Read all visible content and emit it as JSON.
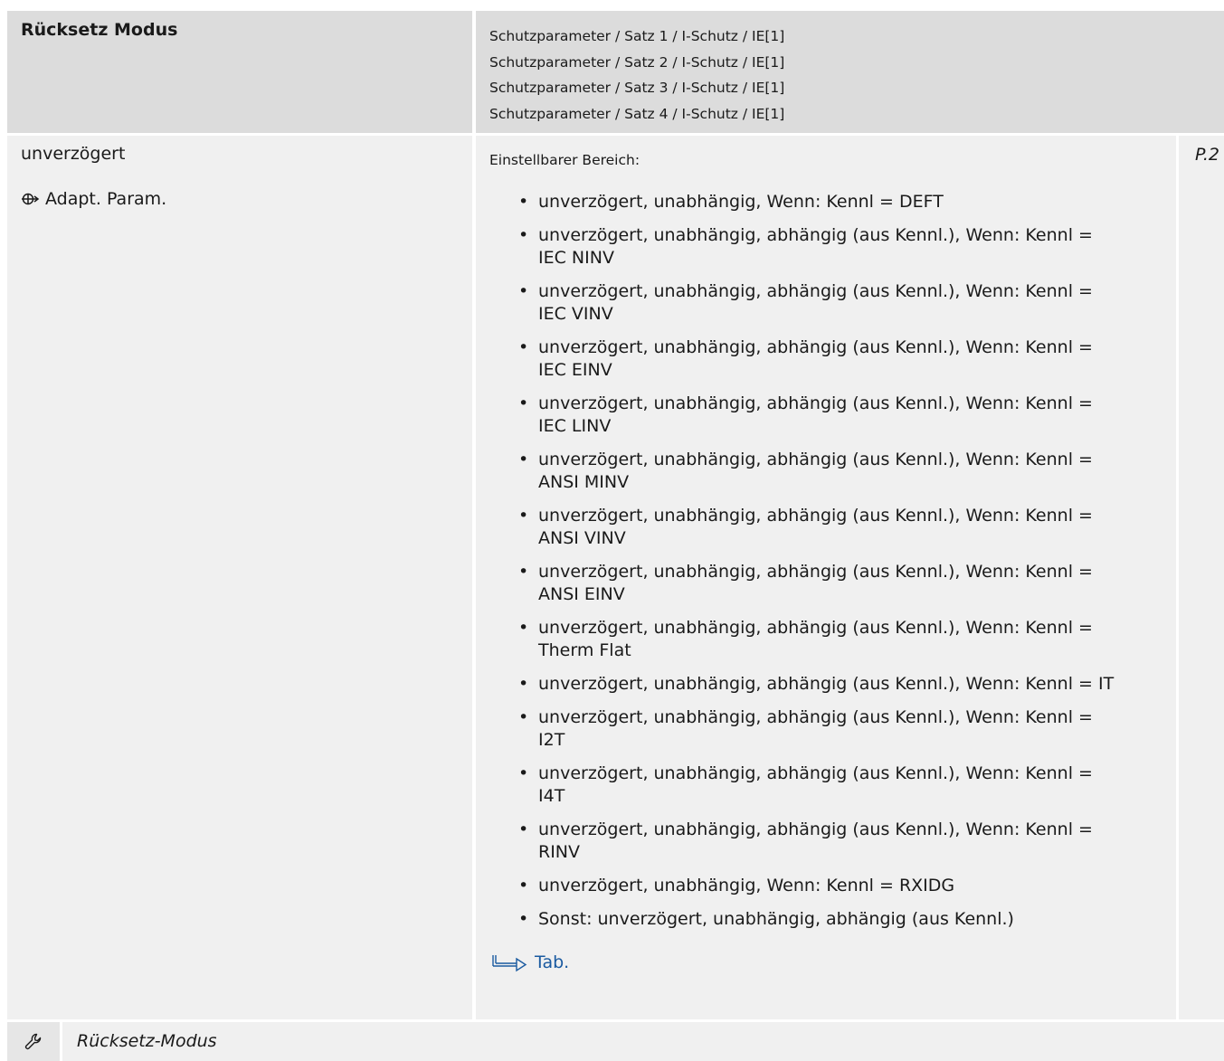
{
  "header": {
    "title": "Rücksetz Modus",
    "paths": [
      "Schutzparameter / Satz 1 / I-Schutz / IE[1]",
      "Schutzparameter / Satz 2 / I-Schutz / IE[1]",
      "Schutzparameter / Satz 3 / I-Schutz / IE[1]",
      "Schutzparameter / Satz 4 / I-Schutz / IE[1]"
    ]
  },
  "body": {
    "default_value": "unverzögert",
    "adapt_label": "Adapt. Param.",
    "adapt_icon": "adaptive-param-icon",
    "range_label": "Einstellbarer Bereich:",
    "range_items": [
      "unverzögert, unabhängig, Wenn: Kennl = DEFT",
      "unverzögert, unabhängig, abhängig (aus Kennl.), Wenn: Kennl = IEC NINV",
      "unverzögert, unabhängig, abhängig (aus Kennl.), Wenn: Kennl = IEC VINV",
      "unverzögert, unabhängig, abhängig (aus Kennl.), Wenn: Kennl = IEC EINV",
      "unverzögert, unabhängig, abhängig (aus Kennl.), Wenn: Kennl = IEC LINV",
      "unverzögert, unabhängig, abhängig (aus Kennl.), Wenn: Kennl = ANSI MINV",
      "unverzögert, unabhängig, abhängig (aus Kennl.), Wenn: Kennl = ANSI VINV",
      "unverzögert, unabhängig, abhängig (aus Kennl.), Wenn: Kennl = ANSI EINV",
      "unverzögert, unabhängig, abhängig (aus Kennl.), Wenn: Kennl = Therm Flat",
      "unverzögert, unabhängig, abhängig (aus Kennl.), Wenn: Kennl = IT",
      "unverzögert, unabhängig, abhängig (aus Kennl.), Wenn: Kennl = I2T",
      "unverzögert, unabhängig, abhängig (aus Kennl.), Wenn: Kennl = I4T",
      "unverzögert, unabhängig, abhängig (aus Kennl.), Wenn: Kennl = RINV",
      "unverzögert, unabhängig, Wenn: Kennl = RXIDG",
      "Sonst:  unverzögert, unabhängig, abhängig (aus Kennl.)"
    ],
    "tab_link": "Tab.",
    "tab_icon": "cross-reference-arrow-icon",
    "param_code": "P.2"
  },
  "footer": {
    "icon": "wrench-icon",
    "text": "Rücksetz-Modus"
  },
  "colors": {
    "header_bg": "#dcdcdc",
    "body_bg": "#f0f0f0",
    "link": "#1a5aa0"
  }
}
